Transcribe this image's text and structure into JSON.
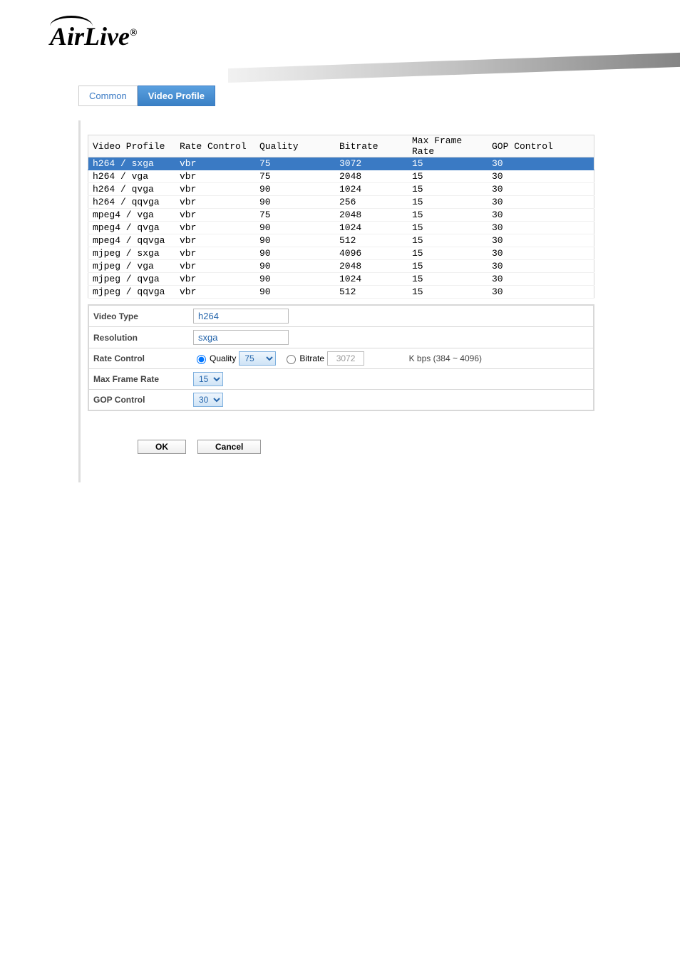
{
  "logo_text": "AirLive",
  "logo_reg": "®",
  "tabs": {
    "common": "Common",
    "video_profile": "Video Profile"
  },
  "table": {
    "headers": {
      "profile": "Video Profile",
      "rate_control": "Rate Control",
      "quality": "Quality",
      "bitrate": "Bitrate",
      "max_frame_rate": "Max Frame Rate",
      "gop_control": "GOP Control"
    },
    "rows": [
      {
        "profile": "h264 / sxga",
        "rc": "vbr",
        "q": "75",
        "br": "3072",
        "fr": "15",
        "gop": "30",
        "selected": true
      },
      {
        "profile": "h264 / vga",
        "rc": "vbr",
        "q": "75",
        "br": "2048",
        "fr": "15",
        "gop": "30"
      },
      {
        "profile": "h264 / qvga",
        "rc": "vbr",
        "q": "90",
        "br": "1024",
        "fr": "15",
        "gop": "30"
      },
      {
        "profile": "h264 / qqvga",
        "rc": "vbr",
        "q": "90",
        "br": "256",
        "fr": "15",
        "gop": "30"
      },
      {
        "profile": "mpeg4 / vga",
        "rc": "vbr",
        "q": "75",
        "br": "2048",
        "fr": "15",
        "gop": "30"
      },
      {
        "profile": "mpeg4 / qvga",
        "rc": "vbr",
        "q": "90",
        "br": "1024",
        "fr": "15",
        "gop": "30"
      },
      {
        "profile": "mpeg4 / qqvga",
        "rc": "vbr",
        "q": "90",
        "br": "512",
        "fr": "15",
        "gop": "30"
      },
      {
        "profile": "mjpeg / sxga",
        "rc": "vbr",
        "q": "90",
        "br": "4096",
        "fr": "15",
        "gop": "30"
      },
      {
        "profile": "mjpeg / vga",
        "rc": "vbr",
        "q": "90",
        "br": "2048",
        "fr": "15",
        "gop": "30"
      },
      {
        "profile": "mjpeg / qvga",
        "rc": "vbr",
        "q": "90",
        "br": "1024",
        "fr": "15",
        "gop": "30"
      },
      {
        "profile": "mjpeg / qqvga",
        "rc": "vbr",
        "q": "90",
        "br": "512",
        "fr": "15",
        "gop": "30"
      }
    ]
  },
  "form": {
    "video_type": {
      "label": "Video Type",
      "value": "h264"
    },
    "resolution": {
      "label": "Resolution",
      "value": "sxga"
    },
    "rate_control": {
      "label": "Rate Control",
      "quality_label": "Quality",
      "quality_value": "75",
      "bitrate_label": "Bitrate",
      "bitrate_value": "3072",
      "bitrate_suffix": "K bps (384 ~ 4096)"
    },
    "max_frame_rate": {
      "label": "Max Frame Rate",
      "value": "15"
    },
    "gop_control": {
      "label": "GOP Control",
      "value": "30"
    }
  },
  "buttons": {
    "ok": "OK",
    "cancel": "Cancel"
  }
}
